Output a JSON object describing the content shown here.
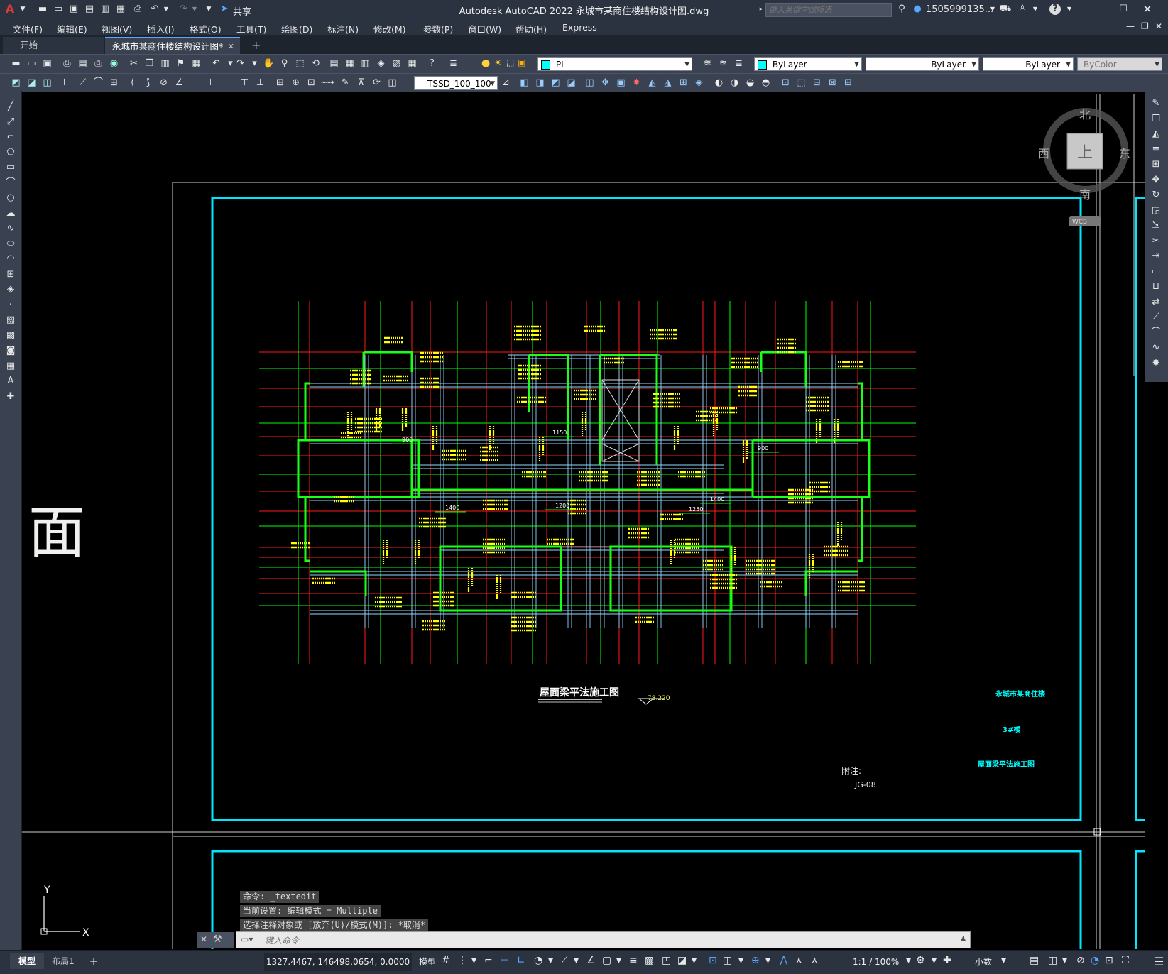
{
  "window": {
    "title": "Autodesk AutoCAD 2022    永城市某商住楼结构设计图.dwg",
    "search_placeholder": "键入关键字或短语",
    "user": "1505999135...",
    "share_label": "共享"
  },
  "menu": [
    "文件(F)",
    "编辑(E)",
    "视图(V)",
    "插入(I)",
    "格式(O)",
    "工具(T)",
    "绘图(D)",
    "标注(N)",
    "修改(M)",
    "参数(P)",
    "窗口(W)",
    "帮助(H)",
    "Express"
  ],
  "tabs": {
    "start": "开始",
    "active": "永城市某商住楼结构设计图*",
    "add": "+"
  },
  "toolbar": {
    "layer": "PL",
    "color": "ByLayer",
    "linetype": "ByLayer",
    "lineweight": "ByLayer",
    "plotstyle": "ByColor",
    "textstyle": "TSSD_100_100"
  },
  "viewcube": {
    "north": "北",
    "south": "南",
    "east": "东",
    "west": "西",
    "top": "上",
    "wcs": "WCS"
  },
  "drawing": {
    "title": "屋面梁平法施工图",
    "level": "78.220",
    "note_label": "附注:",
    "sheet_no": "JG-08",
    "tb_company": "永城市某商住楼",
    "tb_item": "3#楼",
    "tb_title": "屋面梁平法施工图",
    "partial_char": "面",
    "dims": [
      "1400",
      "1400",
      "1150",
      "900",
      "900",
      "1250",
      "1200"
    ]
  },
  "ucs": {
    "y": "Y",
    "x": "X"
  },
  "command": {
    "history": [
      "命令: _textedit",
      "当前设置: 编辑模式 = Multiple",
      "选择注释对象或 [放弃(U)/模式(M)]: *取消*"
    ],
    "placeholder": "键入命令"
  },
  "status": {
    "tab_model": "模型",
    "tab_layout": "布局1",
    "add": "+",
    "coords": "1327.4467, 146498.0654, 0.0000",
    "space": "模型",
    "scale": "1:1 / 100%",
    "units": "小数"
  },
  "colors": {
    "frame": "#00ffff",
    "axis_red": "#ff1a1a",
    "axis_green": "#00ff00",
    "wall": "#1aff1a",
    "beam": "#8fd9ff",
    "label": "#ffff00",
    "chrome": "#2b3341",
    "toolbar": "#3a4150"
  }
}
